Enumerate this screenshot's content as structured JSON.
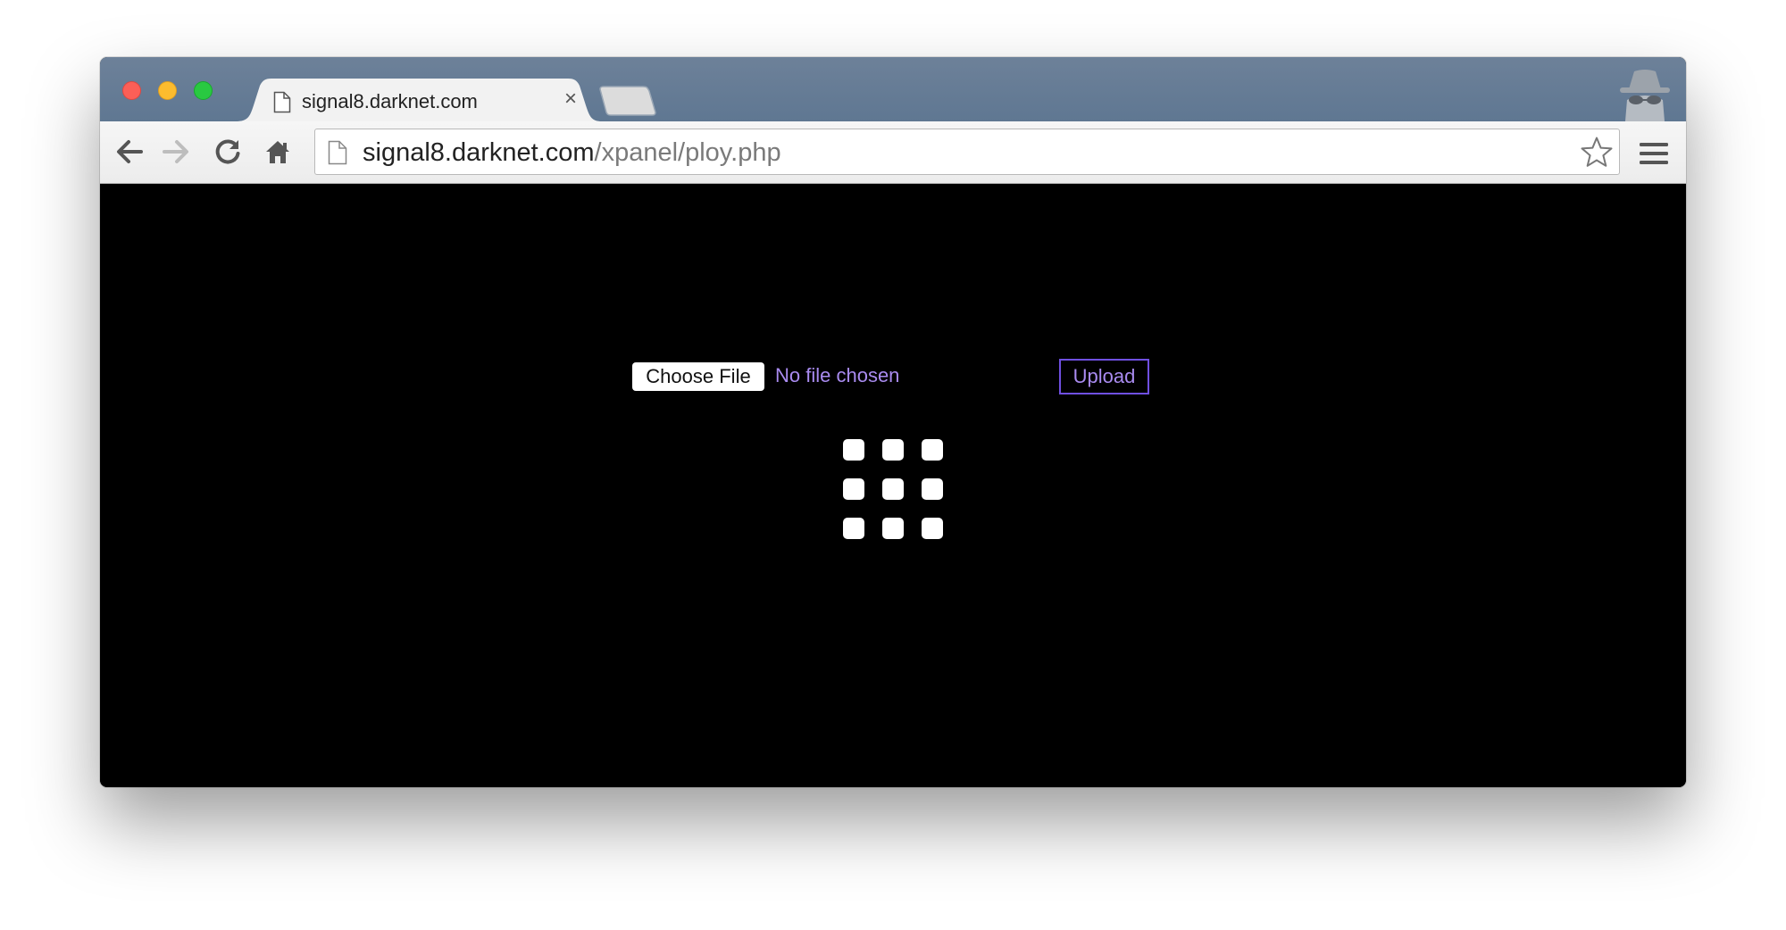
{
  "browser": {
    "tab": {
      "title": "signal8.darknet.com",
      "close_glyph": "×",
      "icon": "page-icon"
    },
    "address_bar": {
      "host": "signal8.darknet.com",
      "path": "/xpanel/ploy.php"
    },
    "toolbar_icons": [
      "back-arrow-icon",
      "forward-arrow-icon",
      "reload-icon",
      "home-icon",
      "star-icon",
      "hamburger-menu-icon"
    ],
    "incognito_icon": "incognito-icon",
    "colors": {
      "titlebar": "#627a95",
      "content_background": "#000000",
      "accent_text": "#a98bf0",
      "upload_border": "#6f4fe0"
    }
  },
  "page": {
    "file_input": {
      "button_label": "Choose File",
      "status": "No file chosen"
    },
    "upload_button": "Upload",
    "loader": "3x3-grid-of-white-squares"
  }
}
